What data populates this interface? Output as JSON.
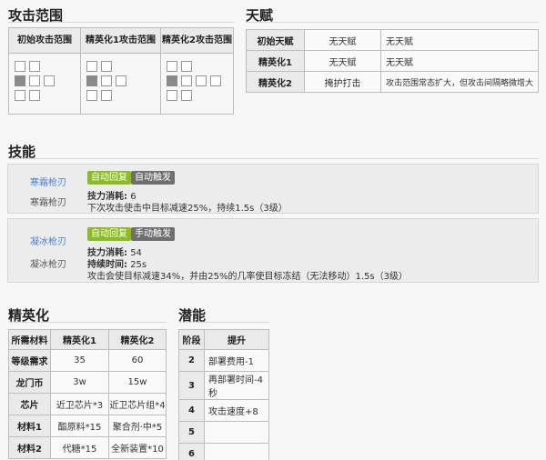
{
  "headings": {
    "range": "攻击范围",
    "talent": "天赋",
    "skills": "技能",
    "elite": "精英化",
    "potential": "潜能"
  },
  "range": {
    "columns": [
      "初始攻击范围",
      "精英化1攻击范围",
      "精英化2攻击范围"
    ]
  },
  "talent": {
    "rows": [
      {
        "stage": "初始天赋",
        "name": "无天赋",
        "desc": "无天赋"
      },
      {
        "stage": "精英化1",
        "name": "无天赋",
        "desc": "无天赋"
      },
      {
        "stage": "精英化2",
        "name": "掩护打击",
        "desc": "攻击范围常态扩大，但攻击间隔略微增大"
      }
    ]
  },
  "skills": [
    {
      "name": "寒霜枪刃",
      "sub": "寒霜枪刃",
      "recovery": "自动回复",
      "trigger": "自动触发",
      "cost_label": "技力消耗:",
      "cost": "6",
      "duration_label": "",
      "duration": "",
      "desc": "下次攻击使击中目标减速25%，持续1.5s（3级）"
    },
    {
      "name": "凝冰枪刃",
      "sub": "凝冰枪刃",
      "recovery": "自动回复",
      "trigger": "手动触发",
      "cost_label": "技力消耗:",
      "cost": "54",
      "duration_label": "持续时间:",
      "duration": "25s",
      "desc": "攻击会使目标减速34%，并由25%的几率使目标冻结（无法移动）1.5s（3级）"
    }
  ],
  "elite": {
    "headers": [
      "所需材料",
      "精英化1",
      "精英化2"
    ],
    "rows": [
      {
        "label": "等级需求",
        "e1": "35",
        "e2": "60"
      },
      {
        "label": "龙门币",
        "e1": "3w",
        "e2": "15w"
      },
      {
        "label": "芯片",
        "e1": "近卫芯片*3",
        "e2": "近卫芯片组*4"
      },
      {
        "label": "材料1",
        "e1": "酯原料*15",
        "e2": "聚合剂·中*5"
      },
      {
        "label": "材料2",
        "e1": "代糖*15",
        "e2": "全新装置*10"
      }
    ]
  },
  "potential": {
    "headers": [
      "阶段",
      "提升"
    ],
    "rows": [
      {
        "stage": "2",
        "desc": "部署费用-1"
      },
      {
        "stage": "3",
        "desc": "再部署时间-4秒"
      },
      {
        "stage": "4",
        "desc": "攻击速度+8"
      },
      {
        "stage": "5",
        "desc": ""
      },
      {
        "stage": "6",
        "desc": ""
      }
    ]
  }
}
